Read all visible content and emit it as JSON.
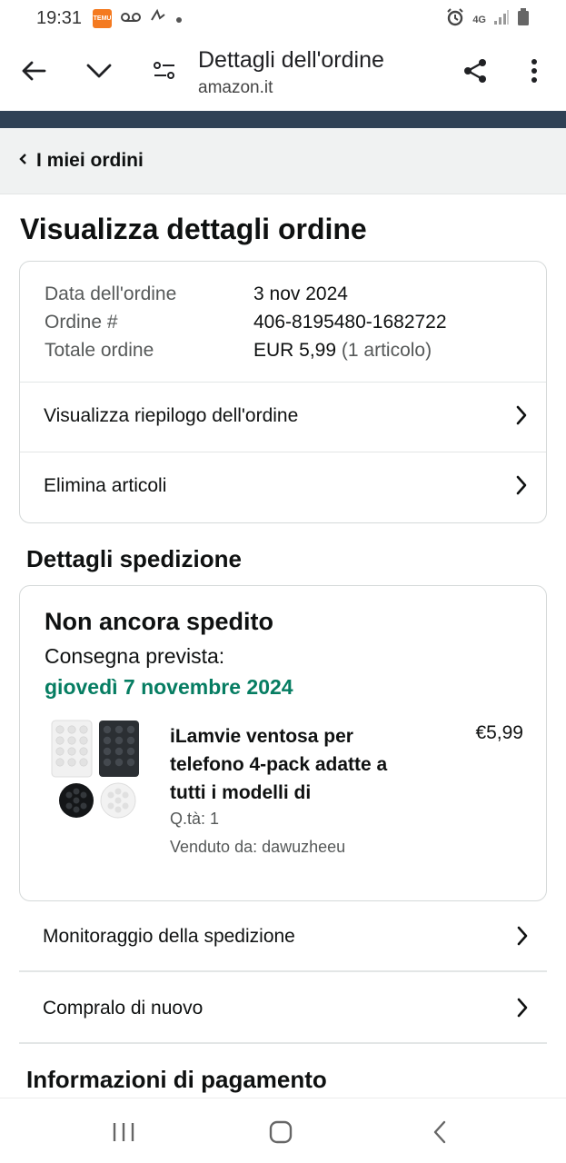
{
  "status_bar": {
    "time": "19:31",
    "temu_label": "TEMU",
    "network": "4G",
    "icons": [
      "temu-app-icon",
      "voicemail-icon",
      "signature-icon",
      "dot-icon",
      "alarm-icon",
      "network-4g-icon",
      "signal-icon",
      "battery-icon"
    ]
  },
  "toolbar": {
    "title": "Dettagli dell'ordine",
    "url": "amazon.it",
    "icons": [
      "back-arrow-icon",
      "chevron-down-icon",
      "page-settings-icon",
      "share-icon",
      "more-vert-icon"
    ]
  },
  "breadcrumb": {
    "label": "I miei ordini"
  },
  "page": {
    "title": "Visualizza dettagli ordine"
  },
  "order_summary": {
    "rows": [
      {
        "label": "Data dell'ordine",
        "value": "3 nov 2024"
      },
      {
        "label": "Ordine #",
        "value": "406-8195480-1682722"
      },
      {
        "label": "Totale ordine",
        "value": "EUR 5,99",
        "extra": "(1 articolo)"
      }
    ],
    "links": [
      "Visualizza riepilogo dell'ordine",
      "Elimina articoli"
    ]
  },
  "shipment": {
    "section_title": "Dettagli spedizione",
    "status": "Non ancora spedito",
    "delivery_label": "Consegna prevista:",
    "delivery_date": "giovedì 7 novembre 2024",
    "product": {
      "name": "iLamvie ventosa per telefono 4-pack adatte a tutti i modelli di",
      "price": "€5,99",
      "qty": "Q.tà: 1",
      "seller": "Venduto da: dawuzheeu"
    },
    "actions": [
      "Monitoraggio della spedizione",
      "Compralo di nuovo"
    ]
  },
  "payment": {
    "section_title": "Informazioni di pagamento"
  },
  "colors": {
    "accent_green": "#067d62",
    "header_dark": "#2f4155",
    "breadcrumb_bg": "#f0f2f2"
  },
  "bottom_nav": {
    "icons": [
      "recent-apps-icon",
      "home-icon",
      "back-icon"
    ]
  }
}
